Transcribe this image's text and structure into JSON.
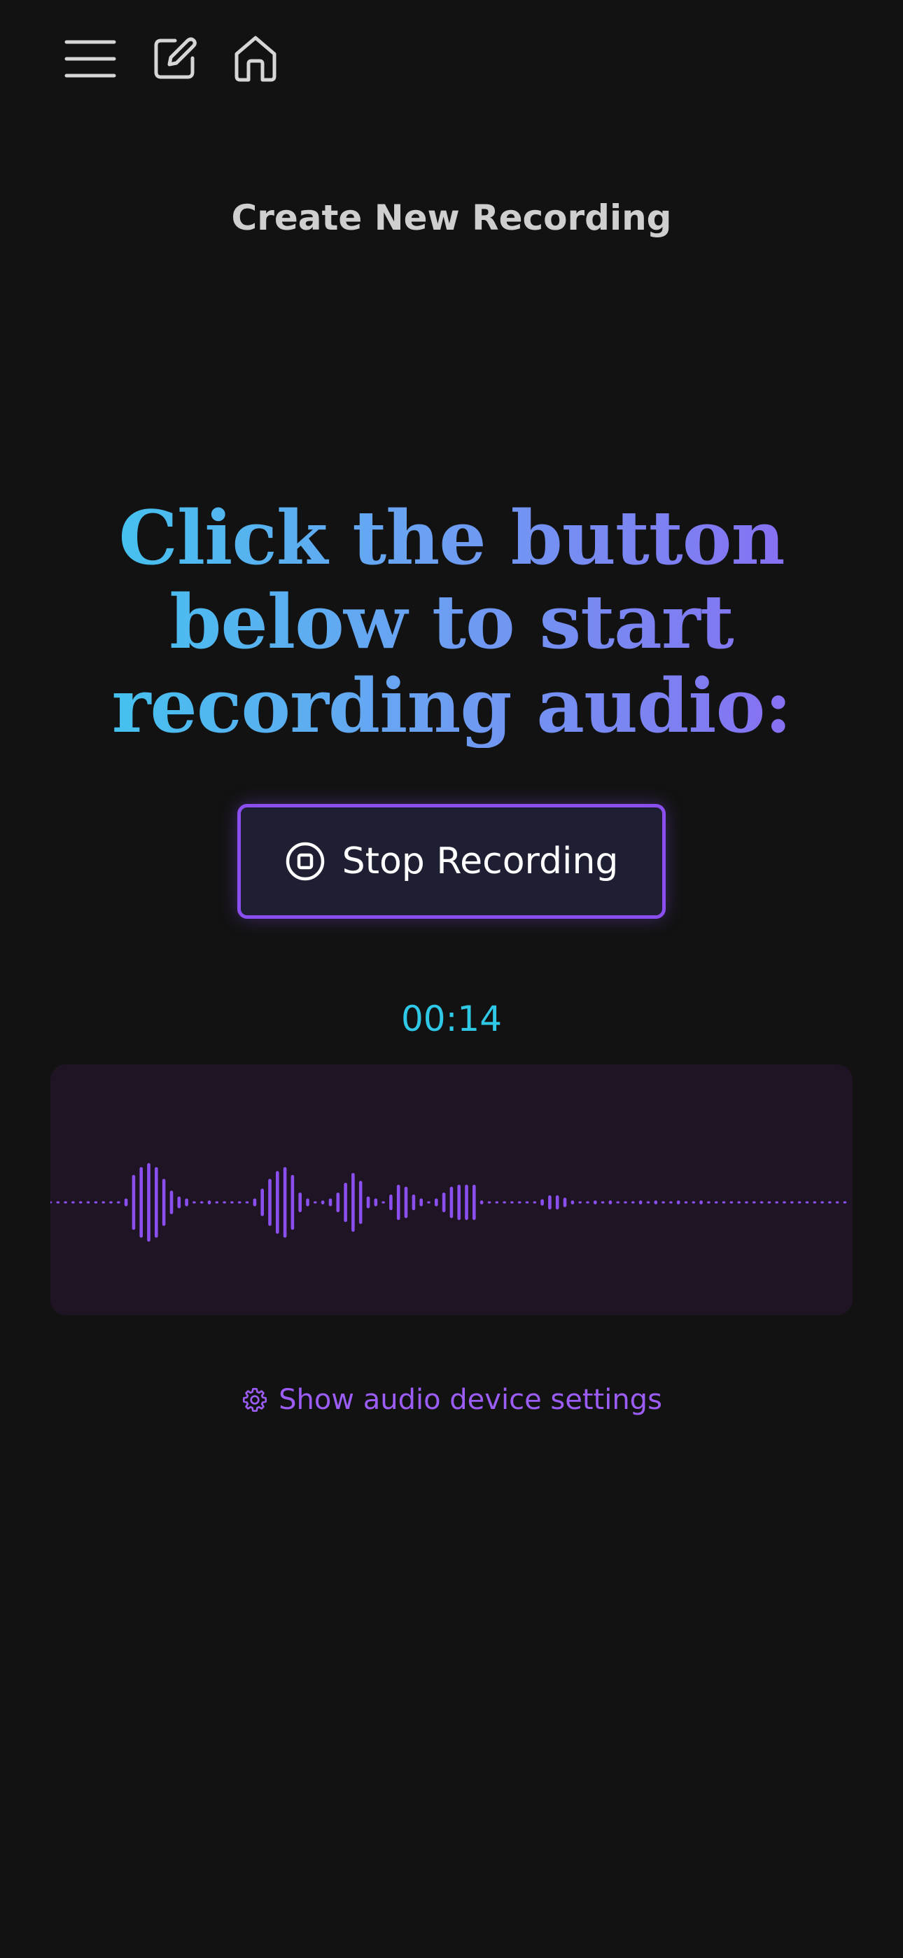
{
  "header": {
    "menu_icon": "hamburger-menu-icon",
    "edit_icon": "edit-icon",
    "home_icon": "home-icon",
    "page_title": "Create New Recording"
  },
  "main": {
    "headline_lines": [
      "Click the button",
      "below to start",
      "recording audio:"
    ],
    "record_button": {
      "label": "Stop Recording",
      "icon": "stop-circle-icon"
    },
    "timer": "00:14",
    "waveform": {
      "color": "#8b4ff0",
      "panel_color": "#1e1424",
      "levels": [
        0,
        0,
        0,
        0,
        0,
        0,
        0,
        0,
        0,
        0,
        0.1,
        0.7,
        0.9,
        1,
        0.9,
        0.6,
        0.3,
        0.15,
        0.1,
        0,
        0,
        0.05,
        0,
        0,
        0,
        0,
        0,
        0.1,
        0.35,
        0.6,
        0.8,
        0.9,
        0.7,
        0.25,
        0.1,
        0,
        0.05,
        0.1,
        0.25,
        0.5,
        0.75,
        0.55,
        0.15,
        0.1,
        0,
        0.2,
        0.45,
        0.4,
        0.2,
        0.1,
        0,
        0.1,
        0.25,
        0.4,
        0.45,
        0.45,
        0.45,
        0.05,
        0,
        0,
        0,
        0,
        0,
        0,
        0,
        0.08,
        0.18,
        0.18,
        0.12,
        0.05,
        0,
        0,
        0.05,
        0,
        0.05,
        0,
        0,
        0,
        0.05,
        0,
        0.05,
        0,
        0,
        0.05,
        0,
        0,
        0.05,
        0,
        0,
        0,
        0,
        0,
        0,
        0,
        0,
        0,
        0,
        0,
        0,
        0,
        0,
        0,
        0,
        0,
        0,
        0
      ]
    },
    "settings_link": {
      "label": "Show audio device settings",
      "icon": "gear-icon"
    }
  },
  "colors": {
    "background": "#121212",
    "accent_purple": "#8b4ff0",
    "timer_cyan": "#2fc8e6",
    "gradient_start": "#3fc6ee",
    "gradient_end": "#8a6af2"
  }
}
